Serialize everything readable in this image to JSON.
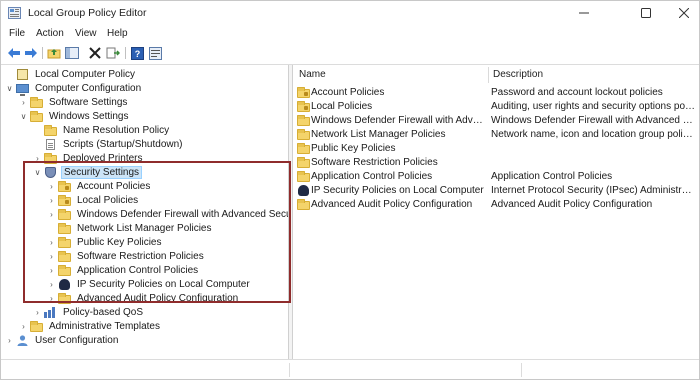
{
  "window": {
    "title": "Local Group Policy Editor",
    "app_icon": "group-policy-icon",
    "controls": [
      "minimize-icon",
      "maximize-icon",
      "close-icon"
    ]
  },
  "menubar": {
    "items": [
      "File",
      "Action",
      "View",
      "Help"
    ]
  },
  "toolbar": {
    "buttons": [
      "back-arrow-icon",
      "forward-arrow-icon",
      "up-folder-icon",
      "show-hide-tree-icon",
      "delete-icon",
      "export-list-icon",
      "help-icon",
      "properties-icon"
    ]
  },
  "tree": {
    "items": [
      {
        "label": "Local Computer Policy",
        "icon": "policy-icon",
        "expanded": true
      },
      {
        "label": "Computer Configuration",
        "icon": "computer-icon",
        "expanded": true
      },
      {
        "label": "Software Settings",
        "icon": "folder-icon",
        "expanded": false
      },
      {
        "label": "Windows Settings",
        "icon": "folder-icon",
        "expanded": true
      },
      {
        "label": "Name Resolution Policy",
        "icon": "folder-icon",
        "expanded": false
      },
      {
        "label": "Scripts (Startup/Shutdown)",
        "icon": "document-icon",
        "expanded": false
      },
      {
        "label": "Deployed Printers",
        "icon": "folder-icon",
        "expanded": false
      },
      {
        "label": "Security Settings",
        "icon": "security-settings-icon",
        "expanded": true,
        "selected": true
      },
      {
        "label": "Account Policies",
        "icon": "folder-icon",
        "expanded": false
      },
      {
        "label": "Local Policies",
        "icon": "folder-icon",
        "expanded": false
      },
      {
        "label": "Windows Defender Firewall with Advanced Security",
        "icon": "folder-icon",
        "expanded": false
      },
      {
        "label": "Network List Manager Policies",
        "icon": "folder-icon",
        "expanded": false
      },
      {
        "label": "Public Key Policies",
        "icon": "folder-icon",
        "expanded": false
      },
      {
        "label": "Software Restriction Policies",
        "icon": "folder-icon",
        "expanded": false
      },
      {
        "label": "Application Control Policies",
        "icon": "folder-icon",
        "expanded": false
      },
      {
        "label": "IP Security Policies on Local Computer",
        "icon": "ipsec-icon",
        "expanded": false
      },
      {
        "label": "Advanced Audit Policy Configuration",
        "icon": "folder-icon",
        "expanded": false
      },
      {
        "label": "Policy-based QoS",
        "icon": "qos-icon",
        "expanded": false
      },
      {
        "label": "Administrative Templates",
        "icon": "folder-icon",
        "expanded": false
      },
      {
        "label": "User Configuration",
        "icon": "user-icon",
        "expanded": false
      }
    ]
  },
  "list": {
    "columns": [
      "Name",
      "Description"
    ],
    "rows": [
      {
        "name": "Account Policies",
        "description": "Password and account lockout policies",
        "icon": "folder-icon"
      },
      {
        "name": "Local Policies",
        "description": "Auditing, user rights and security options polic...",
        "icon": "folder-icon"
      },
      {
        "name": "Windows Defender Firewall with Advanc...",
        "description": "Windows Defender Firewall with Advanced Sec...",
        "icon": "folder-icon"
      },
      {
        "name": "Network List Manager Policies",
        "description": "Network name, icon and location group policies.",
        "icon": "folder-icon"
      },
      {
        "name": "Public Key Policies",
        "description": "",
        "icon": "folder-icon"
      },
      {
        "name": "Software Restriction Policies",
        "description": "",
        "icon": "folder-icon"
      },
      {
        "name": "Application Control Policies",
        "description": "Application Control Policies",
        "icon": "folder-icon"
      },
      {
        "name": "IP Security Policies on Local Computer",
        "description": "Internet Protocol Security (IPsec) Administratio...",
        "icon": "ipsec-icon"
      },
      {
        "name": "Advanced Audit Policy Configuration",
        "description": "Advanced Audit Policy Configuration",
        "icon": "folder-icon"
      }
    ]
  }
}
